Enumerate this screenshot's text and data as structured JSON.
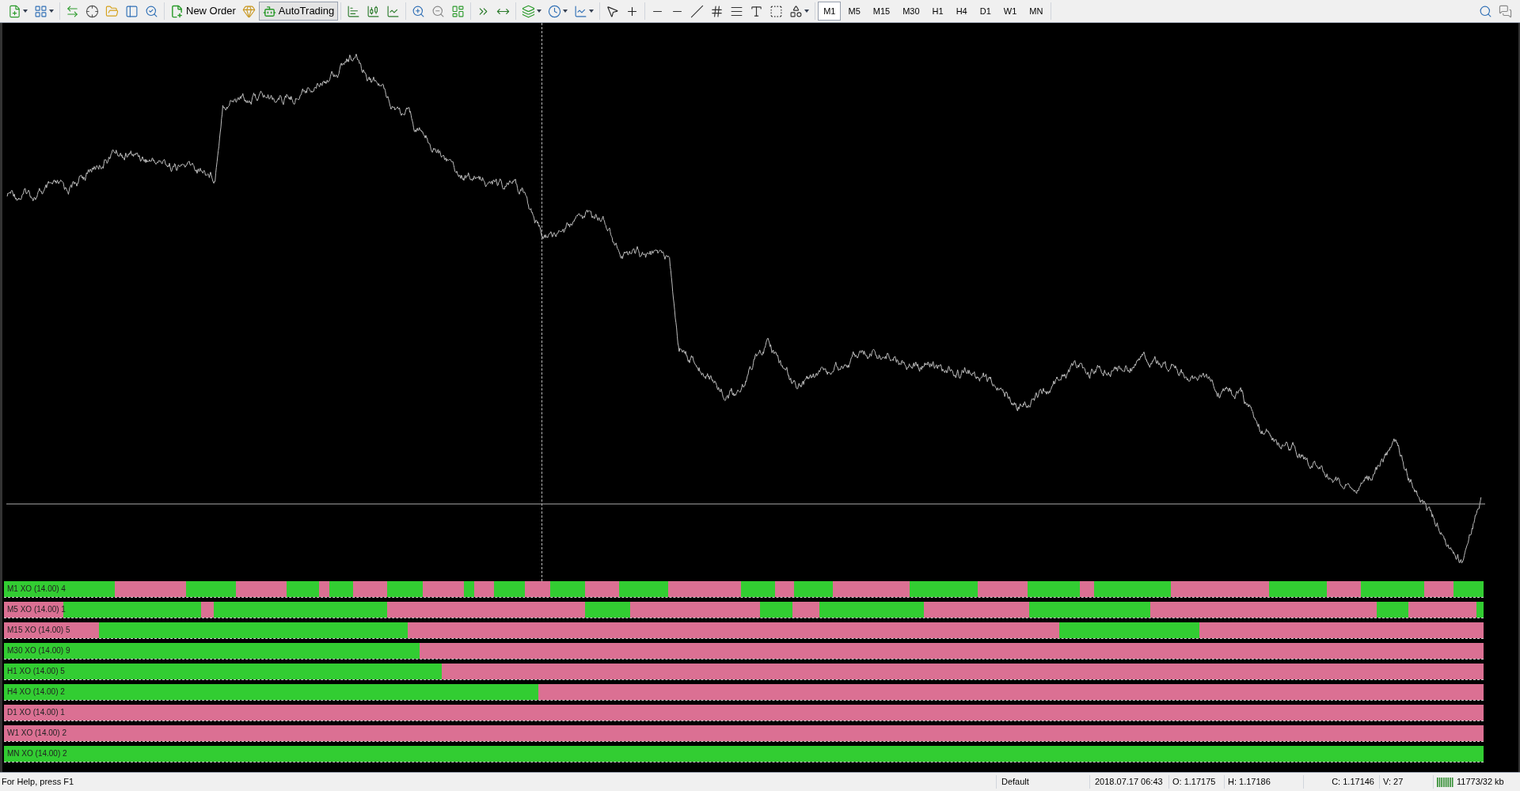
{
  "toolbar": {
    "new_order": "New Order",
    "autotrading": {
      "label": "AutoTrading",
      "on": true
    }
  },
  "timeframes": [
    {
      "label": "M1",
      "selected": true
    },
    {
      "label": "M5",
      "selected": false
    },
    {
      "label": "M15",
      "selected": false
    },
    {
      "label": "M30",
      "selected": false
    },
    {
      "label": "H1",
      "selected": false
    },
    {
      "label": "H4",
      "selected": false
    },
    {
      "label": "D1",
      "selected": false
    },
    {
      "label": "W1",
      "selected": false
    },
    {
      "label": "MN",
      "selected": false
    }
  ],
  "indicators": [
    {
      "label": "M1 XO (14.00) 4",
      "segments": [
        {
          "color": "#32cd32"
        },
        {
          "color": "#db7093"
        },
        {
          "color": "#32cd32"
        },
        {
          "color": "#db7093"
        },
        {
          "color": "#32cd32"
        },
        {
          "color": "#db7093"
        },
        {
          "color": "#32cd32"
        },
        {
          "color": "#db7093"
        },
        {
          "color": "#32cd32"
        },
        {
          "color": "#db7093"
        },
        {
          "color": "#32cd32"
        },
        {
          "color": "#db7093"
        },
        {
          "color": "#32cd32"
        },
        {
          "color": "#db7093"
        },
        {
          "color": "#32cd32"
        },
        {
          "color": "#db7093"
        },
        {
          "color": "#32cd32"
        },
        {
          "color": "#db7093"
        },
        {
          "color": "#32cd32"
        },
        {
          "color": "#db7093"
        },
        {
          "color": "#32cd32"
        },
        {
          "color": "#db7093"
        },
        {
          "color": "#32cd32"
        },
        {
          "color": "#db7093"
        },
        {
          "color": "#32cd32"
        },
        {
          "color": "#db7093"
        },
        {
          "color": "#32cd32"
        },
        {
          "color": "#db7093"
        },
        {
          "color": "#32cd32"
        },
        {
          "color": "#db7093"
        },
        {
          "color": "#32cd32"
        },
        {
          "color": "#db7093"
        },
        {
          "color": "#32cd32"
        }
      ]
    },
    {
      "label": "M5 XO (14.00) 1",
      "segments": [
        {
          "color": "#db7093"
        },
        {
          "color": "#32cd32"
        },
        {
          "color": "#db7093"
        },
        {
          "color": "#32cd32"
        },
        {
          "color": "#db7093"
        },
        {
          "color": "#32cd32"
        },
        {
          "color": "#db7093"
        },
        {
          "color": "#32cd32"
        },
        {
          "color": "#db7093"
        },
        {
          "color": "#32cd32"
        },
        {
          "color": "#db7093"
        },
        {
          "color": "#32cd32"
        },
        {
          "color": "#db7093"
        },
        {
          "color": "#32cd32"
        },
        {
          "color": "#db7093"
        },
        {
          "color": "#32cd32"
        }
      ]
    },
    {
      "label": "M15 XO (14.00) 5",
      "segments": [
        {
          "color": "#db7093"
        },
        {
          "color": "#32cd32"
        },
        {
          "color": "#db7093"
        },
        {
          "color": "#32cd32"
        },
        {
          "color": "#db7093"
        }
      ]
    },
    {
      "label": "M30 XO (14.00) 9",
      "segments": [
        {
          "color": "#32cd32"
        },
        {
          "color": "#db7093"
        }
      ]
    },
    {
      "label": "H1 XO (14.00) 5",
      "segments": [
        {
          "color": "#32cd32"
        },
        {
          "color": "#db7093"
        }
      ]
    },
    {
      "label": "H4 XO (14.00) 2",
      "segments": [
        {
          "color": "#32cd32"
        },
        {
          "color": "#db7093"
        }
      ]
    },
    {
      "label": "D1 XO (14.00) 1",
      "segments": [
        {
          "color": "#db7093"
        }
      ]
    },
    {
      "label": "W1 XO (14.00) 2",
      "segments": [
        {
          "color": "#db7093"
        }
      ]
    },
    {
      "label": "MN XO (14.00) 2",
      "segments": [
        {
          "color": "#32cd32"
        }
      ]
    }
  ],
  "status_bar": {
    "help": "For Help, press F1",
    "profile": "Default",
    "time": "2018.07.17 06:43",
    "open": "O: 1.17175",
    "high": "H: 1.17186",
    "close": "C: 1.17146",
    "volume": "V: 27",
    "traffic": "11773/32 kb"
  }
}
